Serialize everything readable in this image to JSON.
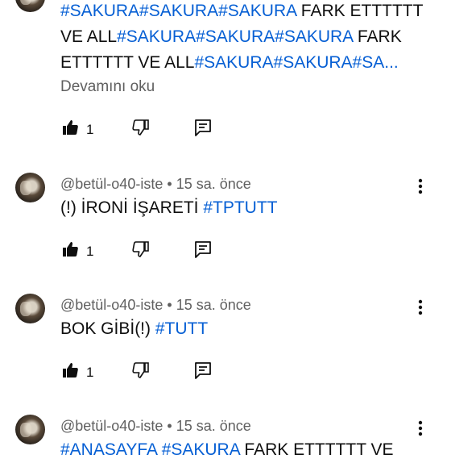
{
  "comments": [
    {
      "id": "top-partial",
      "text_lines": [
        [
          {
            "t": "#SAKURA#SAKURA#SAKURA",
            "tag": true
          },
          {
            "t": " FARK ETTTTTT",
            "tag": false
          }
        ],
        [
          {
            "t": "VE ALL",
            "tag": false
          },
          {
            "t": "#SAKURA#SAKURA#SAKURA",
            "tag": true
          },
          {
            "t": " FARK",
            "tag": false
          }
        ],
        [
          {
            "t": "ETTTTTT VE ALL",
            "tag": false
          },
          {
            "t": "#SAKURA#SAKURA#SA...",
            "tag": true
          }
        ]
      ],
      "read_more": "Devamını oku",
      "likes": "1"
    },
    {
      "id": "c1",
      "author": "@betül-o40-iste",
      "separator": "•",
      "time": "15 sa. önce",
      "text_lines": [
        [
          {
            "t": "(!) İRONİ İŞARETİ ",
            "tag": false
          },
          {
            "t": "#TPTUTT",
            "tag": true
          }
        ]
      ],
      "likes": "1"
    },
    {
      "id": "c2",
      "author": "@betül-o40-iste",
      "separator": "•",
      "time": "15 sa. önce",
      "text_lines": [
        [
          {
            "t": "BOK GİBİ(!) ",
            "tag": false
          },
          {
            "t": "#TUTT",
            "tag": true
          }
        ]
      ],
      "likes": "1"
    },
    {
      "id": "c3",
      "author": "@betül-o40-iste",
      "separator": "•",
      "time": "15 sa. önce",
      "text_lines": [
        [
          {
            "t": "#ANASAYFA",
            "tag": true
          },
          {
            "t": " ",
            "tag": false
          },
          {
            "t": "#SAKURA",
            "tag": true
          },
          {
            "t": " FARK ETTTTTT VE",
            "tag": false
          }
        ]
      ]
    }
  ],
  "colors": {
    "hashtag": "#065fd4",
    "meta_text": "#606060",
    "text": "#0f0f0f"
  }
}
